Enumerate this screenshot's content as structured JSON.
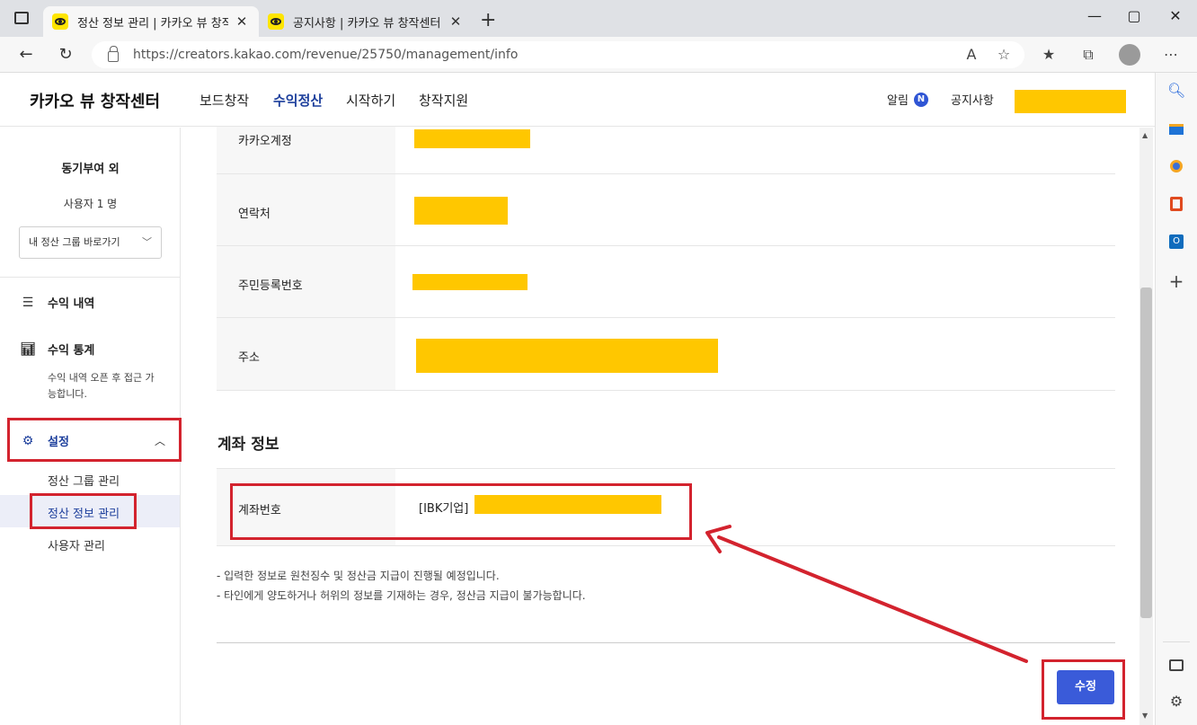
{
  "browser": {
    "tabs": [
      {
        "title": "정산 정보 관리 | 카카오 뷰 창작센터",
        "active": true
      },
      {
        "title": "공지사항 | 카카오 뷰 창작센터",
        "active": false
      }
    ],
    "new_tab": "+",
    "url": "https://creators.kakao.com/revenue/25750/management/info",
    "window": {
      "minimize": "—",
      "maximize": "▢",
      "close": "✕"
    }
  },
  "header": {
    "logo": "카카오 뷰 창작센터",
    "nav": [
      {
        "label": "보드창작",
        "active": false
      },
      {
        "label": "수익정산",
        "active": true
      },
      {
        "label": "시작하기",
        "active": false
      },
      {
        "label": "창작지원",
        "active": false
      }
    ],
    "alarm": "알림",
    "alarm_badge": "N",
    "notice": "공지사항"
  },
  "sidebar": {
    "group_name": "동기부여 외",
    "user_count": "사용자 1 명",
    "group_select": "내 정산 그룹 바로가기",
    "menu": [
      {
        "label": "수익 내역",
        "icon": "list-icon"
      },
      {
        "label": "수익 통계",
        "icon": "bar-chart-icon"
      },
      {
        "label": "설정",
        "icon": "gear-icon"
      }
    ],
    "stats_note": "수익 내역 오픈 후 접근 가능합니다.",
    "settings_sub": [
      "정산 그룹 관리",
      "정산 정보 관리",
      "사용자 관리"
    ]
  },
  "main": {
    "rows": [
      {
        "label": "카카오계정"
      },
      {
        "label": "연락처"
      },
      {
        "label": "주민등록번호"
      },
      {
        "label": "주소"
      }
    ],
    "account_section_title": "계좌 정보",
    "account_row": {
      "label": "계좌번호",
      "bank": "[IBK기업]"
    },
    "notes": [
      "- 입력한 정보로 원천징수 및 정산금 지급이 진행될 예정입니다.",
      "- 타인에게 양도하거나 허위의 정보를 기재하는 경우, 정산금 지급이 불가능합니다."
    ],
    "edit_button": "수정"
  },
  "colors": {
    "accent": "#3a5bd9",
    "mask": "#ffc700",
    "annotation": "#d3232e",
    "active_nav": "#1d3f9c"
  }
}
